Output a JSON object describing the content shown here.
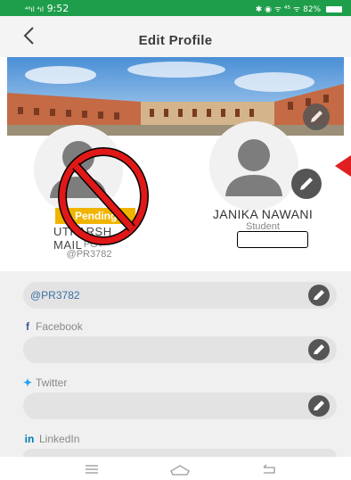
{
  "status_bar": {
    "time": "9:52",
    "signal_left": "⁴⁶ıl ⁴ıl",
    "battery": "82%",
    "icons_text": "✱ ◉ ᯤ ⁴⁵ ᯤ"
  },
  "header": {
    "title": "Edit Profile"
  },
  "user_left": {
    "badge": "Pending",
    "name": "UTKARSH MAIL",
    "role": "PGT",
    "handle": "@PR3782"
  },
  "user_right": {
    "name": "JANIKA NAWANI",
    "role": "Student"
  },
  "fields": {
    "username": {
      "value": "@PR3782"
    },
    "facebook": {
      "label": "Facebook",
      "value": ""
    },
    "twitter": {
      "label": "Twitter",
      "value": ""
    },
    "linkedin": {
      "label": "LinkedIn",
      "value": ""
    }
  },
  "colors": {
    "status_bar": "#1e9e4a",
    "badge": "#f0b400",
    "facebook": "#3b5998",
    "twitter": "#1da1f2",
    "linkedin": "#0077b5",
    "ban": "#e01818",
    "arrow": "#e02020"
  },
  "icons": [
    "back-icon",
    "pencil-icon",
    "user-silhouette-icon",
    "ban-icon",
    "menu-icon",
    "home-icon",
    "back-nav-icon"
  ]
}
